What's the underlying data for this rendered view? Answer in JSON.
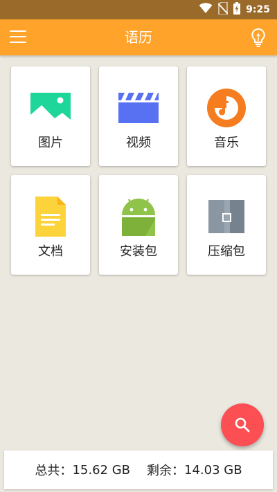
{
  "status_bar": {
    "time": "9:25",
    "icons": [
      "wifi-icon",
      "no-sim-icon",
      "battery-charging-icon"
    ]
  },
  "app_bar": {
    "title": "语历",
    "left_icon": "menu-icon",
    "right_icon": "lightbulb-icon"
  },
  "categories": [
    {
      "label": "图片",
      "icon": "image-icon"
    },
    {
      "label": "视频",
      "icon": "video-icon"
    },
    {
      "label": "音乐",
      "icon": "music-icon"
    },
    {
      "label": "文档",
      "icon": "document-icon"
    },
    {
      "label": "安装包",
      "icon": "android-icon"
    },
    {
      "label": "压缩包",
      "icon": "archive-icon"
    }
  ],
  "fab": {
    "icon": "search-icon",
    "color": "#fb4f54"
  },
  "storage": {
    "total_label": "总共：",
    "total_value": "15.62 GB",
    "free_label": "剩余：",
    "free_value": "14.03 GB"
  },
  "colors": {
    "status_bar": "#9a6a2b",
    "app_bar": "#ffa32a",
    "background": "#ebe8df"
  }
}
